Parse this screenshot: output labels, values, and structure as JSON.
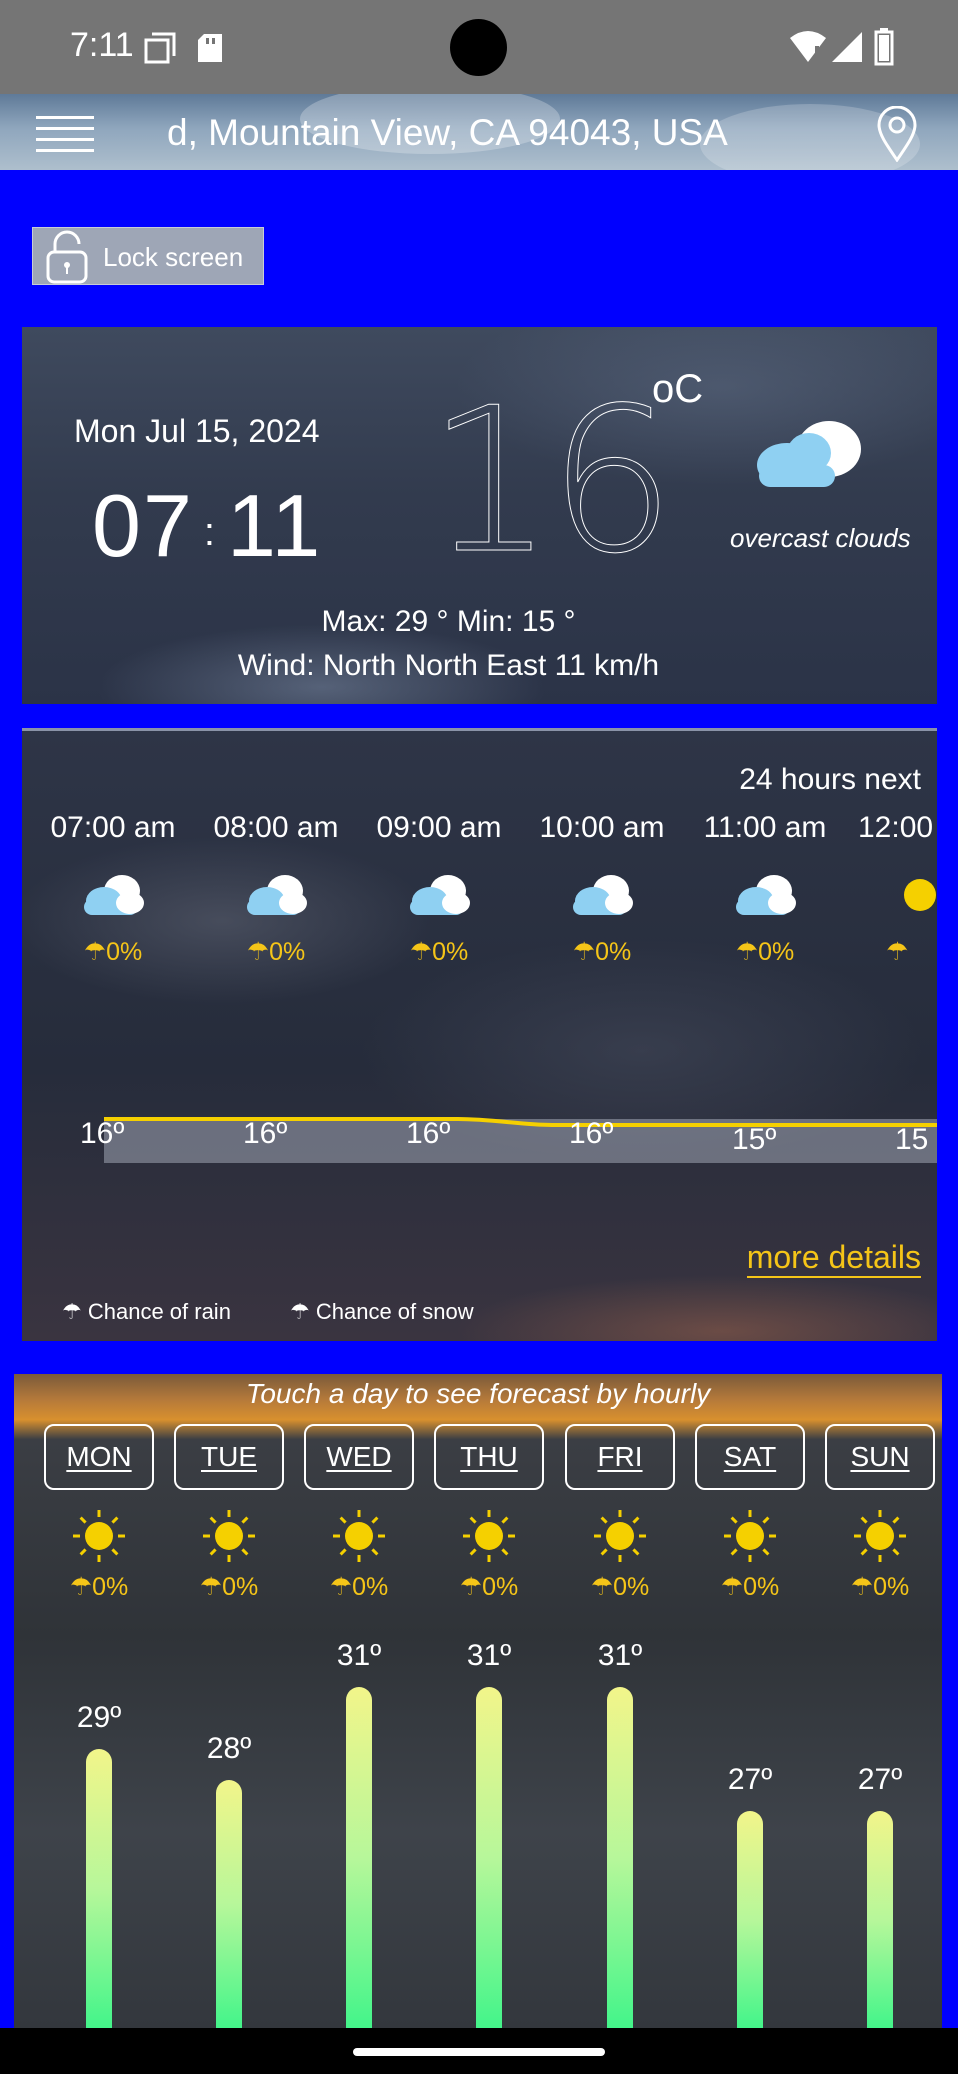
{
  "status_bar": {
    "time": "7:11"
  },
  "toolbar": {
    "location": "d, Mountain View, CA 94043, USA"
  },
  "lock_button": {
    "label": "Lock screen"
  },
  "current": {
    "date": "Mon Jul 15, 2024",
    "clock_hours": "07",
    "clock_sep": ":",
    "clock_minutes": "11",
    "temperature": "16",
    "unit": "oC",
    "condition": "overcast clouds",
    "max_min": "Max: 29 °  Min: 15 °",
    "wind": "Wind: North North East 11 km/h"
  },
  "hourly": {
    "header": "24 hours next",
    "hours": [
      {
        "time": "07:00 am",
        "icon": "cloud-icon",
        "rain": "0%",
        "temp": "16º"
      },
      {
        "time": "08:00 am",
        "icon": "cloud-icon",
        "rain": "0%",
        "temp": "16º"
      },
      {
        "time": "09:00 am",
        "icon": "cloud-icon",
        "rain": "0%",
        "temp": "16º"
      },
      {
        "time": "10:00 am",
        "icon": "cloud-icon",
        "rain": "0%",
        "temp": "16º"
      },
      {
        "time": "11:00 am",
        "icon": "cloud-icon",
        "rain": "0%",
        "temp": "15º"
      },
      {
        "time": "12:00",
        "icon": "sun-icon",
        "rain": "",
        "temp": "15"
      }
    ],
    "more_details": "more details",
    "legend_rain": "Chance of rain",
    "legend_snow": "Chance of snow"
  },
  "daily": {
    "hint": "Touch a day to see forecast by hourly",
    "days": [
      {
        "label": "MON",
        "icon": "sun-icon",
        "rain": "0%",
        "max": "29º",
        "max_value": 29
      },
      {
        "label": "TUE",
        "icon": "sun-icon",
        "rain": "0%",
        "max": "28º",
        "max_value": 28
      },
      {
        "label": "WED",
        "icon": "sun-icon",
        "rain": "0%",
        "max": "31º",
        "max_value": 31
      },
      {
        "label": "THU",
        "icon": "sun-icon",
        "rain": "0%",
        "max": "31º",
        "max_value": 31
      },
      {
        "label": "FRI",
        "icon": "sun-icon",
        "rain": "0%",
        "max": "31º",
        "max_value": 31
      },
      {
        "label": "SAT",
        "icon": "sun-icon",
        "rain": "0%",
        "max": "27º",
        "max_value": 27
      },
      {
        "label": "SUN",
        "icon": "sun-icon",
        "rain": "0%",
        "max": "27º",
        "max_value": 27
      }
    ]
  },
  "colors": {
    "background": "#0000ff",
    "accent": "#f5c518",
    "bar_top": "#f2f58a",
    "bar_bottom": "#43f58a"
  }
}
